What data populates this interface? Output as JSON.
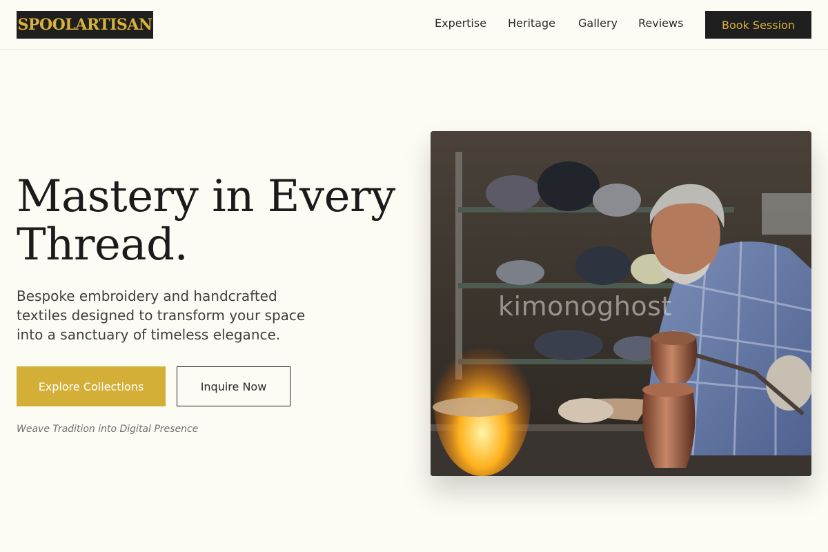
{
  "brand": {
    "logo_text": "SPOOLARTISAN"
  },
  "nav": {
    "items": [
      "Expertise",
      "Heritage",
      "Gallery",
      "Reviews"
    ],
    "cta_label": "Book Session"
  },
  "hero": {
    "title": "Mastery in Every Thread.",
    "subtitle": "Bespoke embroidery and handcrafted textiles designed to transform your space into a sanctuary of timeless elegance.",
    "primary_button": "Explore Collections",
    "secondary_button": "Inquire Now",
    "tagline": "Weave Tradition into Digital Presence",
    "image_watermark": "kimonoghost"
  },
  "colors": {
    "background": "#fdfcf4",
    "dark": "#1f1f1f",
    "gold": "#d4af37",
    "logo_gold": "#d8b23a"
  }
}
